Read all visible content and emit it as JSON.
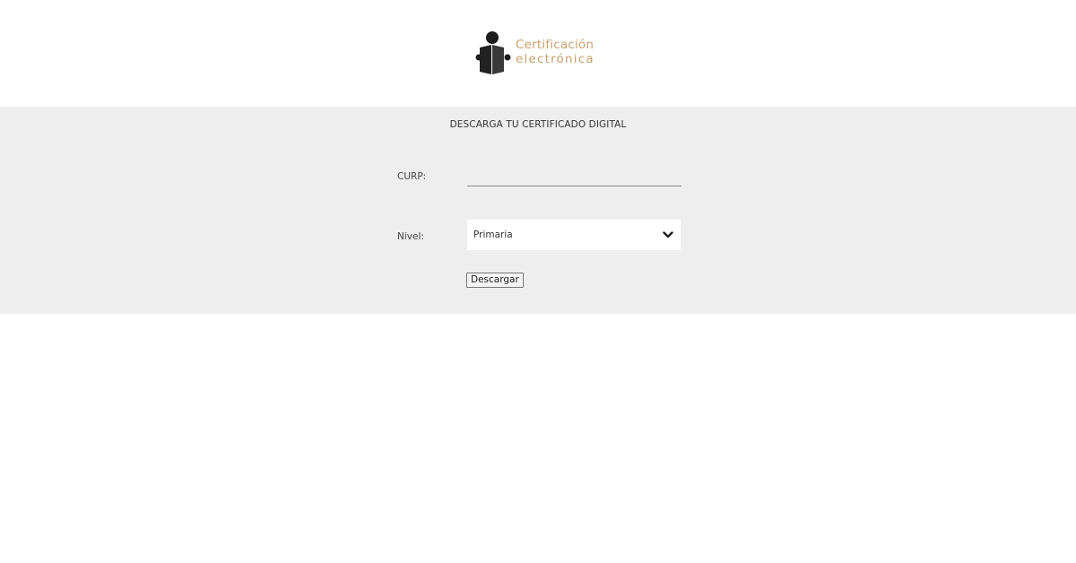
{
  "header": {
    "logo": {
      "line1": "Certificación",
      "line2": "electrónica",
      "icon": "reader-person-icon",
      "text_color": "#c8a06a"
    }
  },
  "panel": {
    "title": "DESCARGA TU CERTIFICADO DIGITAL",
    "background": "#eeeeee",
    "curp": {
      "label": "CURP:",
      "value": "",
      "placeholder": ""
    },
    "nivel": {
      "label": "Nivel:",
      "selected": "Primaria",
      "icon": "chevron-down-icon"
    },
    "download_button": "Descargar"
  }
}
